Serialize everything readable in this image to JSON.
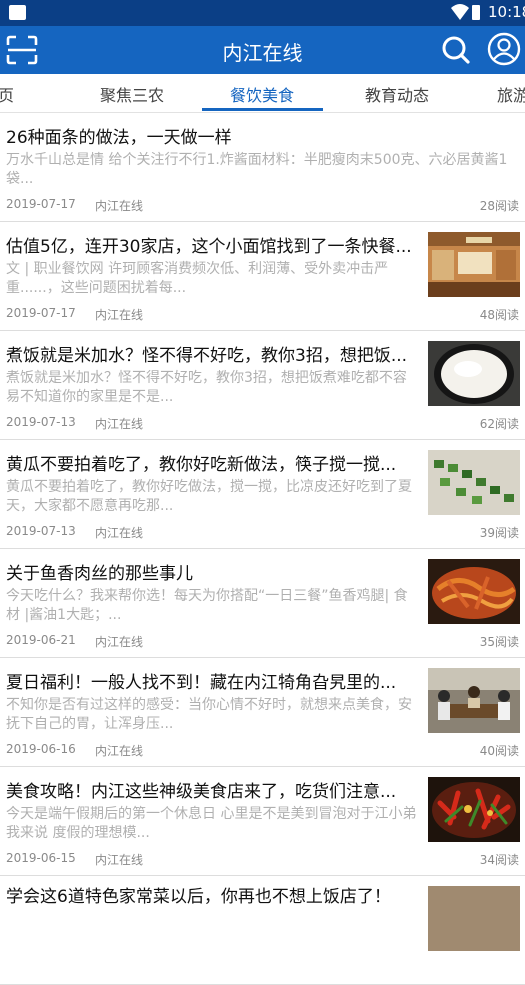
{
  "status": {
    "time": "10:18"
  },
  "header": {
    "title": "内江在线"
  },
  "tabs": [
    {
      "label": "页"
    },
    {
      "label": "聚焦三农"
    },
    {
      "label": "餐饮美食"
    },
    {
      "label": "教育动态"
    },
    {
      "label": "旅游"
    }
  ],
  "articles": [
    {
      "title": "26种面条的做法，一天做一样",
      "summary": "万水千山总是情 给个关注行不行1.炸酱面材料：半肥瘦肉末500克、六必居黄酱1袋...",
      "date": "2019-07-17",
      "source": "内江在线",
      "reads": "28阅读"
    },
    {
      "title": "估值5亿，连开30家店，这个小面馆找到了一条快餐...",
      "summary": "文 | 职业餐饮网 许珂顾客消费频次低、利润薄、受外卖冲击严重......，这些问题困扰着每...",
      "date": "2019-07-17",
      "source": "内江在线",
      "reads": "48阅读"
    },
    {
      "title": "煮饭就是米加水？怪不得不好吃，教你3招，想把饭...",
      "summary": "煮饭就是米加水？怪不得不好吃，教你3招，想把饭煮难吃都不容易不知道你的家里是不是...",
      "date": "2019-07-13",
      "source": "内江在线",
      "reads": "62阅读"
    },
    {
      "title": "黄瓜不要拍着吃了，教你好吃新做法，筷子搅一搅...",
      "summary": "黄瓜不要拍着吃了，教你好吃做法，搅一搅，比凉皮还好吃到了夏天，大家都不愿意再吃那...",
      "date": "2019-07-13",
      "source": "内江在线",
      "reads": "39阅读"
    },
    {
      "title": "关于鱼香肉丝的那些事儿",
      "summary": "今天吃什么？我来帮你选！每天为你搭配“一日三餐”鱼香鸡腿| 食材 |酱油1大匙；...",
      "date": "2019-06-21",
      "source": "内江在线",
      "reads": "35阅读"
    },
    {
      "title": "夏日福利！一般人找不到！藏在内江犄角旮旯里的...",
      "summary": "不知你是否有过这样的感受：当你心情不好时，就想来点美食，安抚下自己的胃，让浑身压...",
      "date": "2019-06-16",
      "source": "内江在线",
      "reads": "40阅读"
    },
    {
      "title": "美食攻略！内江这些神级美食店来了，吃货们注意...",
      "summary": "今天是端午假期后的第一个休息日 心里是不是美到冒泡对于江小弟我来说 度假的理想模...",
      "date": "2019-06-15",
      "source": "内江在线",
      "reads": "34阅读"
    },
    {
      "title": "学会这6道特色家常菜以后，你再也不想上饭店了！"
    }
  ]
}
